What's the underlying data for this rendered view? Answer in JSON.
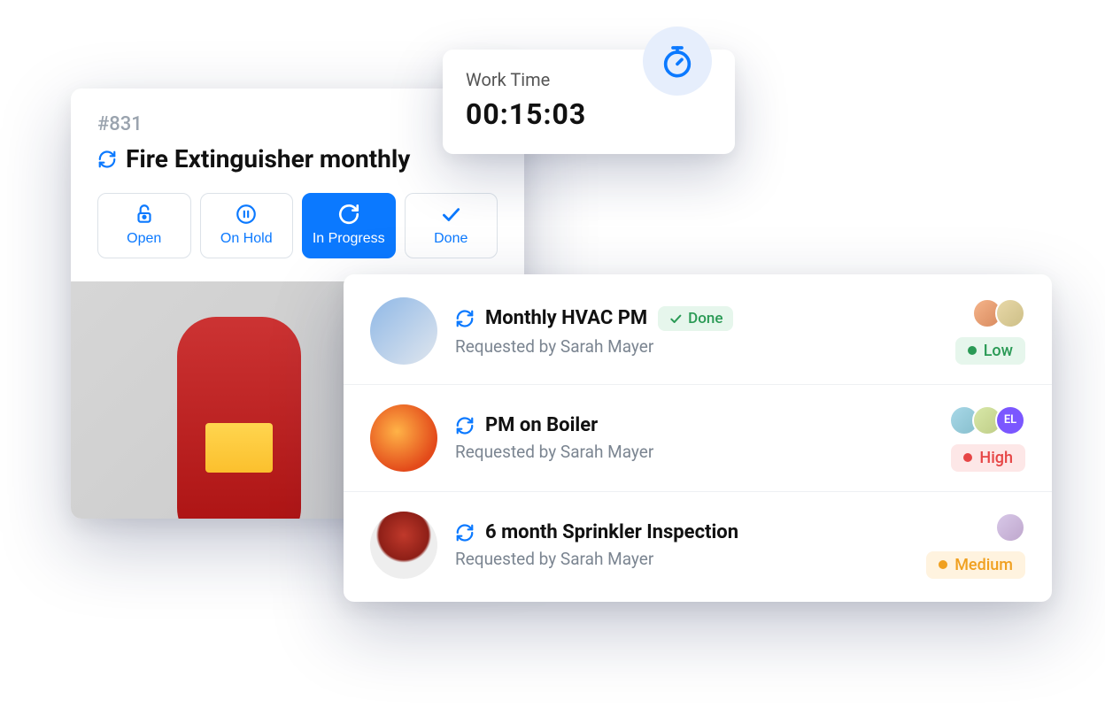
{
  "workOrder": {
    "id": "#831",
    "title": "Fire Extinguisher monthly",
    "statuses": {
      "open": "Open",
      "onHold": "On Hold",
      "inProgress": "In Progress",
      "done": "Done"
    }
  },
  "timer": {
    "label": "Work Time",
    "value": "00:15:03"
  },
  "tasks": [
    {
      "title": "Monthly HVAC PM",
      "requester": "Requested by Sarah Mayer",
      "status": "Done",
      "priority": "Low",
      "assignees": [
        "",
        ""
      ]
    },
    {
      "title": "PM on Boiler",
      "requester": "Requested by Sarah Mayer",
      "status": "",
      "priority": "High",
      "assignees": [
        "",
        "",
        "EL"
      ]
    },
    {
      "title": "6 month Sprinkler Inspection",
      "requester": "Requested by Sarah Mayer",
      "status": "",
      "priority": "Medium",
      "assignees": [
        ""
      ]
    }
  ]
}
